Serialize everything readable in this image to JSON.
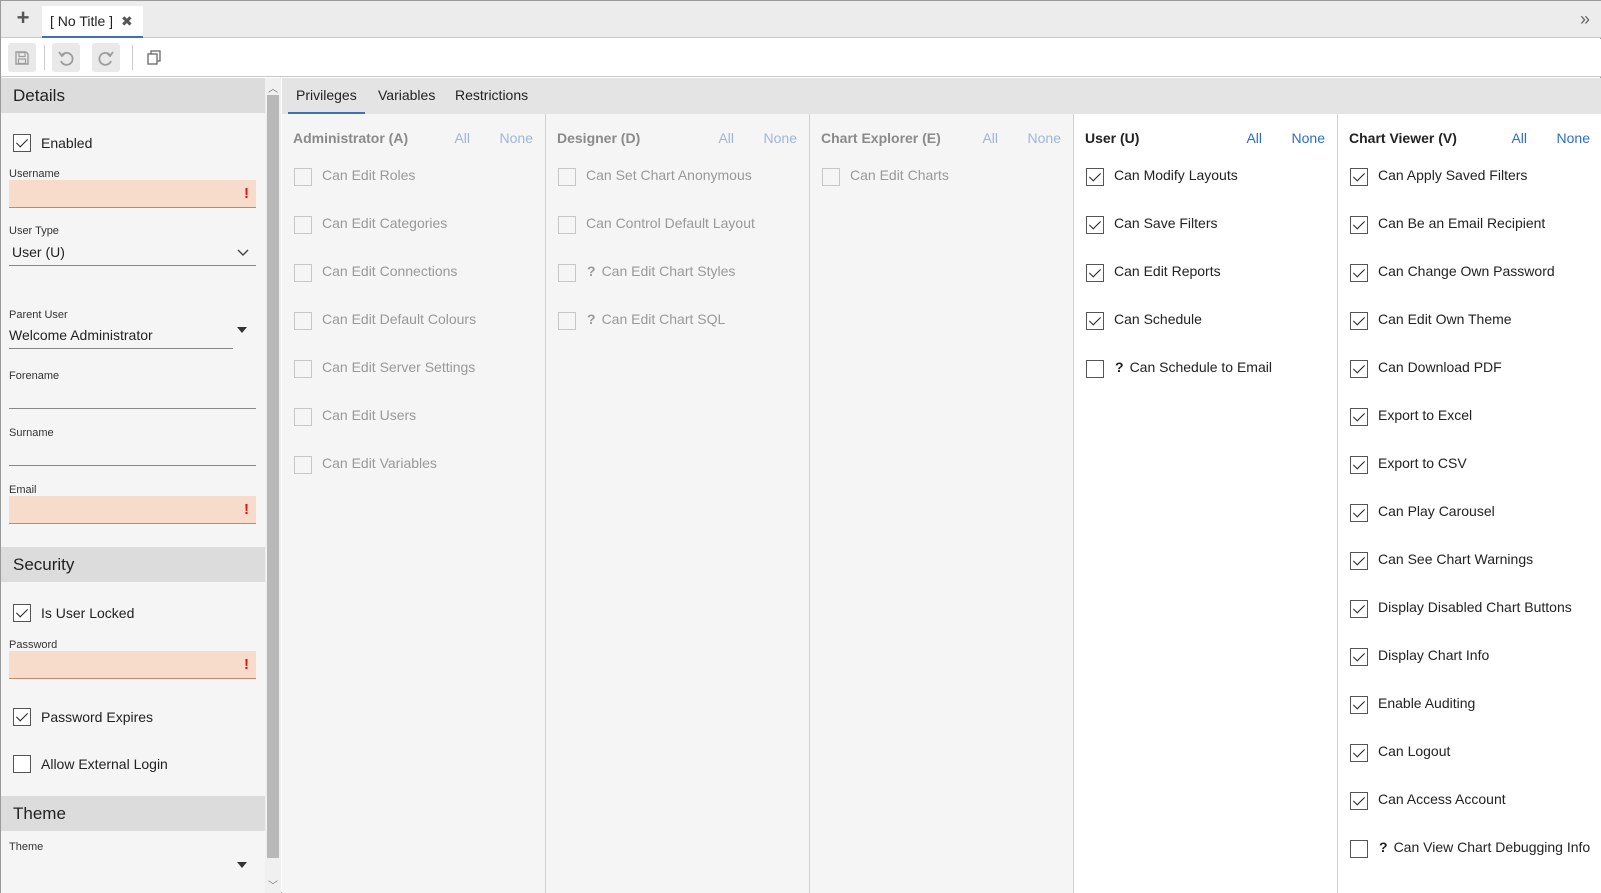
{
  "tabbar": {
    "plus_icon": "plus-icon",
    "tab_title": "[ No Title ]",
    "close_icon": "close-icon",
    "expand_icon": "double-chevron-right-icon"
  },
  "toolbar": {
    "icons": [
      "save-icon",
      "undo-icon",
      "redo-icon",
      "copy-icon"
    ]
  },
  "sidebar": {
    "details_header": "Details",
    "enabled_label": "Enabled",
    "enabled_checked": true,
    "username_label": "Username",
    "username_value": "",
    "user_type_label": "User Type",
    "user_type_value": "User (U)",
    "parent_user_label": "Parent User",
    "parent_user_value": "Welcome Administrator",
    "forename_label": "Forename",
    "surname_label": "Surname",
    "email_label": "Email",
    "security_header": "Security",
    "is_user_locked_label": "Is User Locked",
    "is_user_locked_checked": true,
    "password_label": "Password",
    "password_expires_label": "Password Expires",
    "password_expires_checked": true,
    "allow_external_login_label": "Allow External Login",
    "allow_external_login_checked": false,
    "theme_header": "Theme",
    "theme_label": "Theme",
    "error_mark": "!"
  },
  "main_tabs": [
    "Privileges",
    "Variables",
    "Restrictions"
  ],
  "columns": [
    {
      "title": "Administrator (A)",
      "all": "All",
      "none": "None",
      "enabled": false,
      "items": [
        {
          "label": "Can Edit Roles",
          "checked": false,
          "help": false
        },
        {
          "label": "Can Edit Categories",
          "checked": false,
          "help": false
        },
        {
          "label": "Can Edit Connections",
          "checked": false,
          "help": false
        },
        {
          "label": "Can Edit Default Colours",
          "checked": false,
          "help": false
        },
        {
          "label": "Can Edit Server Settings",
          "checked": false,
          "help": false
        },
        {
          "label": "Can Edit Users",
          "checked": false,
          "help": false
        },
        {
          "label": "Can Edit Variables",
          "checked": false,
          "help": false
        }
      ]
    },
    {
      "title": "Designer (D)",
      "all": "All",
      "none": "None",
      "enabled": false,
      "items": [
        {
          "label": "Can Set Chart Anonymous",
          "checked": false,
          "help": false
        },
        {
          "label": "Can Control Default Layout",
          "checked": false,
          "help": false
        },
        {
          "label": "Can Edit Chart Styles",
          "checked": false,
          "help": true
        },
        {
          "label": "Can Edit Chart SQL",
          "checked": false,
          "help": true
        }
      ]
    },
    {
      "title": "Chart Explorer (E)",
      "all": "All",
      "none": "None",
      "enabled": false,
      "items": [
        {
          "label": "Can Edit Charts",
          "checked": false,
          "help": false
        }
      ]
    },
    {
      "title": "User (U)",
      "all": "All",
      "none": "None",
      "enabled": true,
      "items": [
        {
          "label": "Can Modify Layouts",
          "checked": true,
          "help": false
        },
        {
          "label": "Can Save Filters",
          "checked": true,
          "help": false
        },
        {
          "label": "Can Edit Reports",
          "checked": true,
          "help": false
        },
        {
          "label": "Can Schedule",
          "checked": true,
          "help": false
        },
        {
          "label": "Can Schedule to Email",
          "checked": false,
          "help": true
        }
      ]
    },
    {
      "title": "Chart Viewer (V)",
      "all": "All",
      "none": "None",
      "enabled": true,
      "items": [
        {
          "label": "Can Apply Saved Filters",
          "checked": true,
          "help": false
        },
        {
          "label": "Can Be an Email Recipient",
          "checked": true,
          "help": false
        },
        {
          "label": "Can Change Own Password",
          "checked": true,
          "help": false
        },
        {
          "label": "Can Edit Own Theme",
          "checked": true,
          "help": false
        },
        {
          "label": "Can Download PDF",
          "checked": true,
          "help": false
        },
        {
          "label": "Export to Excel",
          "checked": true,
          "help": false
        },
        {
          "label": "Export to CSV",
          "checked": true,
          "help": false
        },
        {
          "label": "Can Play Carousel",
          "checked": true,
          "help": false
        },
        {
          "label": "Can See Chart Warnings",
          "checked": true,
          "help": false
        },
        {
          "label": "Display Disabled Chart Buttons",
          "checked": true,
          "help": false
        },
        {
          "label": "Display Chart Info",
          "checked": true,
          "help": false
        },
        {
          "label": "Enable Auditing",
          "checked": true,
          "help": false
        },
        {
          "label": "Can Logout",
          "checked": true,
          "help": false
        },
        {
          "label": "Can Access Account",
          "checked": true,
          "help": false
        },
        {
          "label": "Can View Chart Debugging Info",
          "checked": false,
          "help": true
        }
      ]
    }
  ],
  "help_mark": "?"
}
